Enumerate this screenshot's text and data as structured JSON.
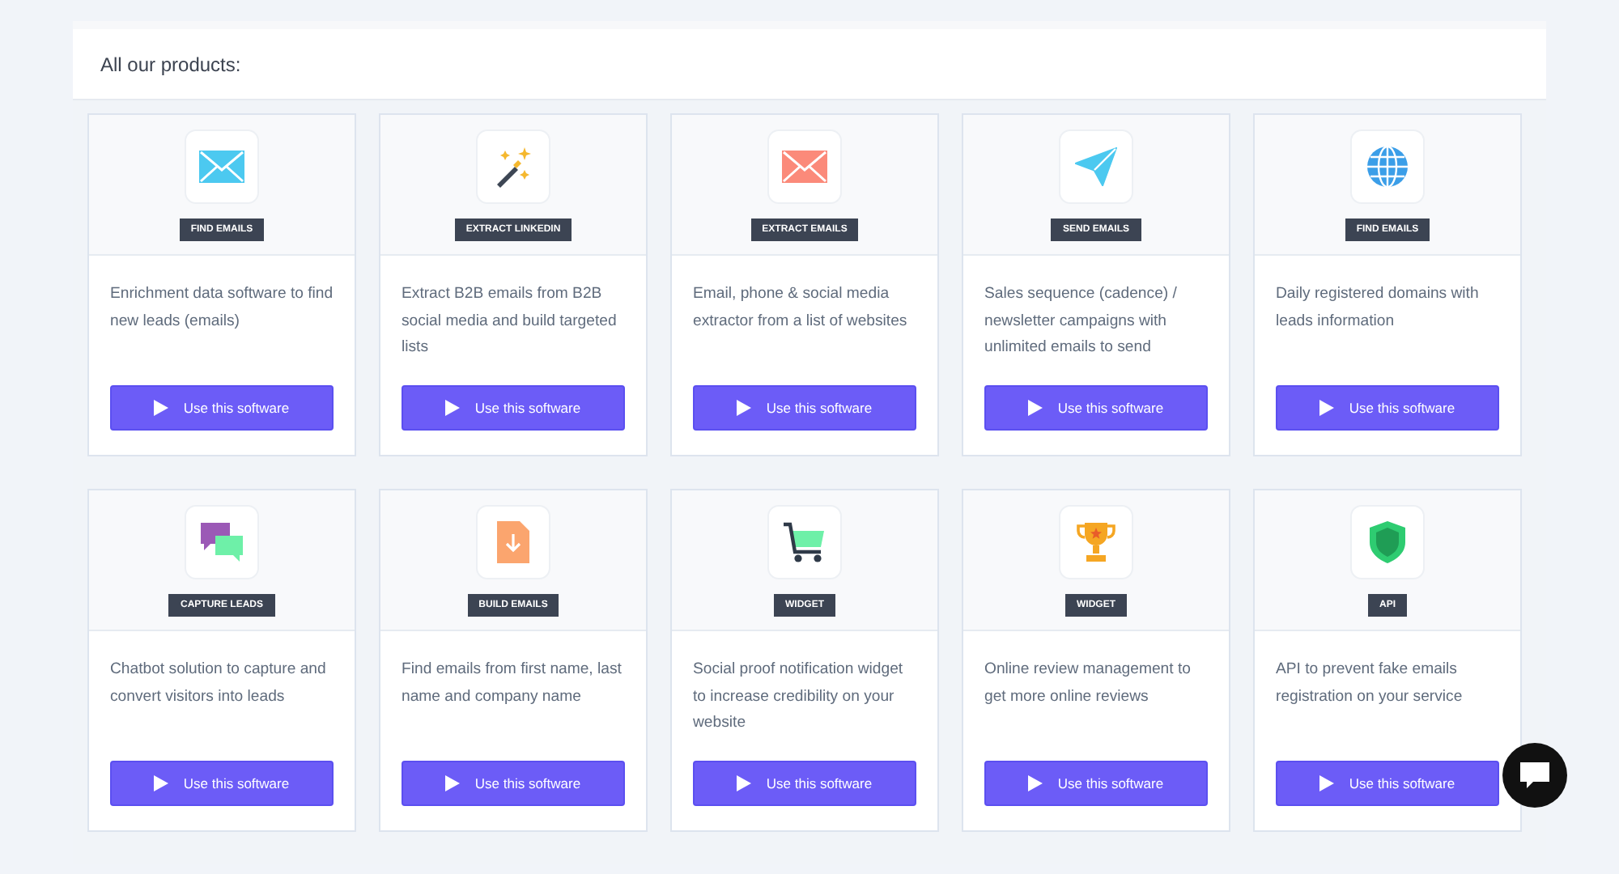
{
  "heading": "All our products:",
  "products": [
    {
      "kind": "envelope",
      "color": "#4cc9f0",
      "tag": "FIND EMAILS",
      "description": "Enrichment data software to find new leads (emails)",
      "button": "Use this software"
    },
    {
      "kind": "wand",
      "color": "#f5b82e",
      "tag": "EXTRACT LINKEDIN",
      "description": "Extract B2B emails from B2B social media and build targeted lists",
      "button": "Use this software"
    },
    {
      "kind": "envelope",
      "color": "#fb8a7a",
      "tag": "EXTRACT EMAILS",
      "description": "Email, phone & social media extractor from a list of websites",
      "button": "Use this software"
    },
    {
      "kind": "plane",
      "color": "#4cc9f0",
      "tag": "SEND EMAILS",
      "description": "Sales sequence (cadence) / newsletter campaigns with unlimited emails to send",
      "button": "Use this software"
    },
    {
      "kind": "globe",
      "color": "#3b9ee8",
      "tag": "FIND EMAILS",
      "description": "Daily registered domains with leads information",
      "button": "Use this software"
    },
    {
      "kind": "chat",
      "color": "#9b59b6",
      "tag": "CAPTURE LEADS",
      "description": "Chatbot solution to capture and convert visitors into leads",
      "button": "Use this software"
    },
    {
      "kind": "file",
      "color": "#fba56e",
      "tag": "BUILD EMAILS",
      "description": "Find emails from first name, last name and company name",
      "button": "Use this software"
    },
    {
      "kind": "cart",
      "color": "#6ef0a8",
      "tag": "WIDGET",
      "description": "Social proof notification widget to increase credibility on your website",
      "button": "Use this software"
    },
    {
      "kind": "trophy",
      "color": "#f5a623",
      "tag": "WIDGET",
      "description": "Online review management to get more online reviews",
      "button": "Use this software"
    },
    {
      "kind": "shield",
      "color": "#2ecc71",
      "tag": "API",
      "description": "API to prevent fake emails registration on your service",
      "button": "Use this software"
    }
  ]
}
